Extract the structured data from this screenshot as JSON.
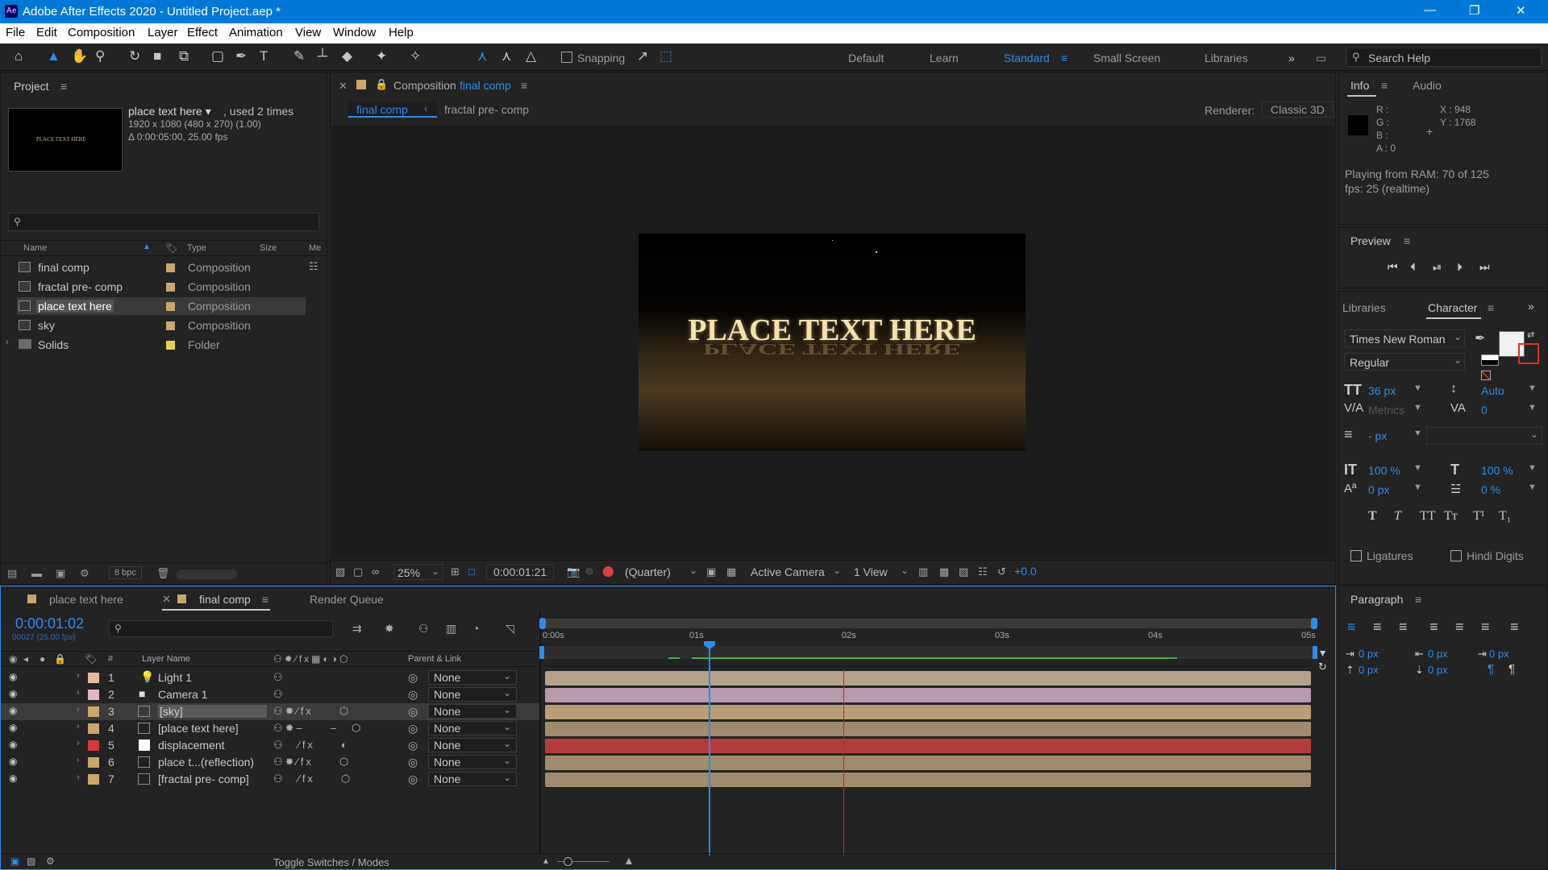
{
  "window": {
    "title": "Adobe After Effects 2020 - Untitled Project.aep *",
    "app_icon": "Ae"
  },
  "menu": [
    "File",
    "Edit",
    "Composition",
    "Layer",
    "Effect",
    "Animation",
    "View",
    "Window",
    "Help"
  ],
  "toolbar": {
    "snapping": "Snapping",
    "workspaces": [
      "Default",
      "Learn",
      "Standard",
      "Small Screen",
      "Libraries"
    ],
    "active_workspace": "Standard",
    "search_placeholder": "Search Help"
  },
  "project": {
    "title": "Project",
    "thumb_text": "PLACE TEXT HERE",
    "selected_name": "place text here ▾",
    "used": ", used 2 times",
    "dims": "1920 x 1080  (480 x 270) (1.00)",
    "duration": "Δ 0:00:05:00, 25.00 fps",
    "columns": [
      "Name",
      "Type",
      "Size",
      "Me"
    ],
    "items": [
      {
        "name": "final comp",
        "type": "Composition",
        "color": "#c9a66b"
      },
      {
        "name": "fractal pre- comp",
        "type": "Composition",
        "color": "#c9a66b"
      },
      {
        "name": "place text here",
        "type": "Composition",
        "color": "#c9a66b"
      },
      {
        "name": "sky",
        "type": "Composition",
        "color": "#c9a66b"
      },
      {
        "name": "Solids",
        "type": "Folder",
        "color": "#e6d14a"
      }
    ],
    "bpc": "8 bpc"
  },
  "composition": {
    "header": "Composition",
    "header_name": "final comp",
    "tabs": [
      "final comp",
      "fractal pre- comp"
    ],
    "renderer_label": "Renderer:",
    "renderer": "Classic 3D",
    "viewer_text": "PLACE TEXT HERE",
    "zoom": "25%",
    "timecode": "0:00:01:21",
    "resolution": "(Quarter)",
    "camera": "Active Camera",
    "views": "1 View",
    "exposure": "+0.0"
  },
  "info": {
    "tabs": [
      "Info",
      "Audio"
    ],
    "r": "R :",
    "g": "G :",
    "b": "B :",
    "a": "A : 0",
    "x": "X : 948",
    "y": "Y : 1768",
    "ram": "Playing from RAM: 70 of 125",
    "fps": "fps: 25 (realtime)"
  },
  "preview": {
    "title": "Preview"
  },
  "character": {
    "tabs": [
      "Libraries",
      "Character"
    ],
    "font": "Times New Roman",
    "style": "Regular",
    "size": "36 px",
    "leading": "Auto",
    "kerning": "Metrics",
    "tracking": "0",
    "stroke": "- px",
    "vscale": "100 %",
    "hscale": "100 %",
    "baseline": "0 px",
    "tsume": "0 %",
    "ligatures": "Ligatures",
    "hindi": "Hindi Digits"
  },
  "paragraph": {
    "title": "Paragraph",
    "v1": "0 px",
    "v2": "0 px",
    "v3": "0 px",
    "v4": "0 px",
    "v5": "0 px"
  },
  "timeline": {
    "tabs": [
      "place text here",
      "final comp",
      "Render Queue"
    ],
    "timecode": "0:00:01:02",
    "frames": "00027 (25.00 fps)",
    "col_layer_name": "Layer Name",
    "col_parent": "Parent & Link",
    "ruler": [
      "0:00s",
      "01s",
      "02s",
      "03s",
      "04s",
      "05s"
    ],
    "layers": [
      {
        "num": "1",
        "name": "Light 1",
        "color": "#e8b9a0",
        "bar": "#b4a38a",
        "parent": "None"
      },
      {
        "num": "2",
        "name": "Camera 1",
        "color": "#e6b6c8",
        "bar": "#b79aab",
        "parent": "None"
      },
      {
        "num": "3",
        "name": "[sky]",
        "color": "#c9a66b",
        "bar": "#b89e79",
        "parent": "None"
      },
      {
        "num": "4",
        "name": "[place text here]",
        "color": "#c9a66b",
        "bar": "#9e8a6c",
        "parent": "None"
      },
      {
        "num": "5",
        "name": "displacement",
        "color": "#d43a3a",
        "bar": "#b33c3c",
        "parent": "None"
      },
      {
        "num": "6",
        "name": "place t...(reflection)",
        "color": "#c9a66b",
        "bar": "#9e8a6c",
        "parent": "None"
      },
      {
        "num": "7",
        "name": "[fractal pre- comp]",
        "color": "#c9a66b",
        "bar": "#9e8a6c",
        "parent": "None"
      }
    ],
    "toggle": "Toggle Switches / Modes"
  }
}
